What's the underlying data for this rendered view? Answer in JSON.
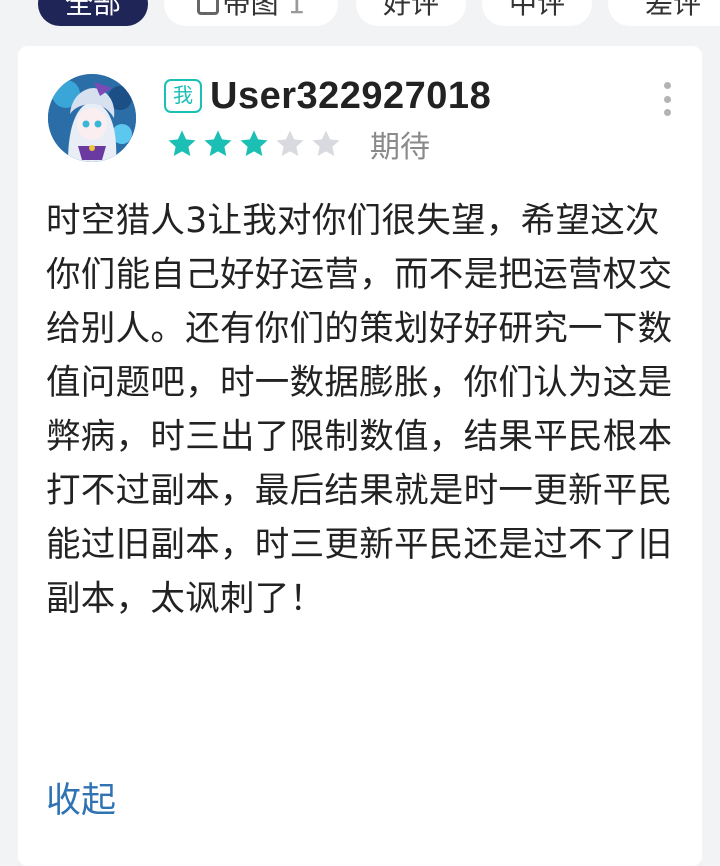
{
  "filters": {
    "all": "全部",
    "with_image": "带图",
    "with_image_count": "1",
    "positive": "好评",
    "neutral": "中评",
    "negative": "差评"
  },
  "review": {
    "me_badge": "我",
    "username": "User322927018",
    "rating": 3,
    "rating_max": 5,
    "rating_label": "期待",
    "content": "时空猎人3让我对你们很失望，希望这次你们能自己好好运营，而不是把运营权交给别人。还有你们的策划好好研究一下数值问题吧，时一数据膨胀，你们认为这是弊病，时三出了限制数值，结果平民根本打不过副本，最后结果就是时一更新平民能过旧副本，时三更新平民还是过不了旧副本，太讽刺了！",
    "collapse_label": "收起"
  },
  "colors": {
    "accent_teal": "#1bbfb4",
    "star_off": "#d8dadf",
    "link_blue": "#2f73b3",
    "active_chip": "#1f2556"
  }
}
